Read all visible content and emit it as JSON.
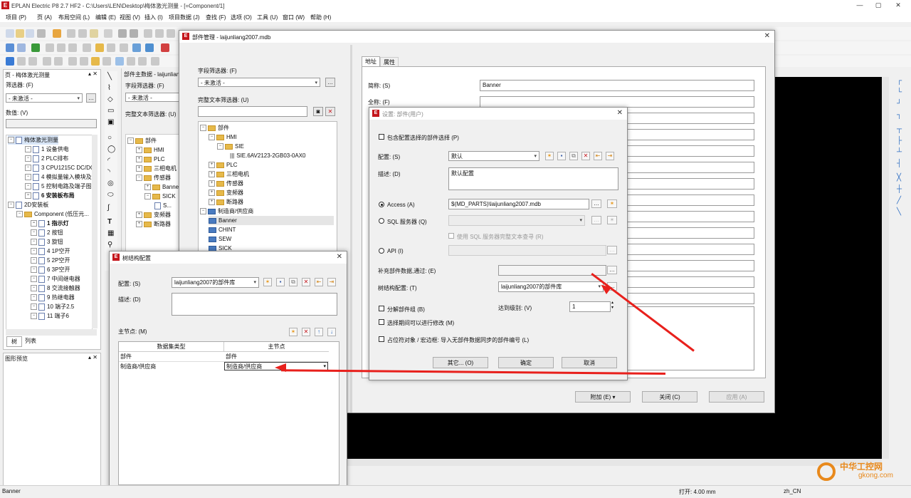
{
  "app": {
    "title": "EPLAN Electric P8 2.7 HF2 - C:\\Users\\LEN\\Desktop\\梅体激光测量 - [=Component/1]",
    "window_controls": [
      "—",
      "▢",
      "✕"
    ]
  },
  "menu": [
    "项目 (P)",
    "页 (A)",
    "布局空间 (L)",
    "编辑 (E)",
    "视图 (V)",
    "插入 (I)",
    "项目数据 (J)",
    "查找 (F)",
    "选项 (O)",
    "工具 (U)",
    "窗口 (W)",
    "帮助 (H)"
  ],
  "page_nav": {
    "title": "页 - 梅体激光测量",
    "filter_label": "筛选器: (F)",
    "filter_value": "- 未激活 -",
    "value_label": "数值: (V)",
    "tree": [
      "梅体激光测量",
      "1 设备供电",
      "2 PLC排布",
      "3 CPU1215C DC/DC",
      "4 模拟量输入模块及...",
      "5 控制电路及端子图...",
      "6 安装板布局",
      "2D安装板",
      "Component (低压元...",
      "1 指示灯",
      "2 按钮",
      "3 旋钮",
      "4 1P空开",
      "5 2P空开",
      "6 3P空开",
      "7 中间继电器",
      "8 交流接触器",
      "9 热继电器",
      "10 端子2.5",
      "11 端子6"
    ],
    "tabs": [
      "树",
      "列表"
    ]
  },
  "graphics_preview": {
    "title": "图形预览"
  },
  "parts_master_strip": {
    "title": "部件主数据 - laijunlian...",
    "field_filter_label": "字段筛选器: (F)",
    "field_filter_value": "- 未激活 -",
    "fulltext_label": "完整文本筛选器: (U)",
    "tree": [
      "部件",
      "HMI",
      "PLC",
      "三相电机",
      "传感器",
      "Banner",
      "SICK",
      "S...",
      "变频器",
      "断路器"
    ]
  },
  "parts_mgmt": {
    "title": "部件管理 - laijunliang2007.mdb",
    "field_filter_label": "字段筛选器: (F)",
    "field_filter_value": "- 未激活 -",
    "fulltext_label": "完整文本筛选器: (U)",
    "tree": [
      "部件",
      "HMI",
      "SIE",
      "SIE.6AV2123-2GB03-0AX0",
      "PLC",
      "三相电机",
      "传感器",
      "变频器",
      "断路器",
      "制造商/供应商",
      "Banner",
      "CHINT",
      "SEW",
      "SICK"
    ],
    "tabs": [
      "地址",
      "属性"
    ],
    "fields": {
      "short_name_label": "简称: (S)",
      "short_name_value": "Banner",
      "full_name_label": "全称: (F)"
    },
    "buttons": {
      "extras": "附加 (E)",
      "close": "关闭 (C)",
      "apply": "应用 (A)"
    }
  },
  "settings_dialog": {
    "title": "设置: 部件(用户)",
    "include_config_label": "包含配置选择的部件选择 (P)",
    "config_label": "配置: (S)",
    "config_value": "默认",
    "desc_label": "描述: (D)",
    "desc_value": "默认配置",
    "access_label": "Access (A)",
    "access_value": "$(MD_PARTS)\\laijunliang2007.mdb",
    "sql_label": "SQL 服务器 (Q)",
    "sql_fulltext_label": "使用 SQL 服务器完整文本查寻 (R)",
    "api_label": "API (I)",
    "supplement_label": "补充部件数据,通过: (E)",
    "tree_config_label": "树结构配置: (T)",
    "tree_config_value": "laijunliang2007的部件库",
    "split_group_label": "分解部件组 (B)",
    "level_label": "达到级别: (V)",
    "level_value": "1",
    "modify_label": "选择期间可以进行修改 (M)",
    "placeholder_label": "占位符对象 / 宏边框: 导入无部件数据同步的部件编号 (L)",
    "buttons": {
      "other": "其它... (O)",
      "ok": "确定",
      "cancel": "取消"
    }
  },
  "tree_config_dialog": {
    "title": "树结构配置",
    "config_label": "配置: (S)",
    "config_value": "laijunliang2007的部件库",
    "desc_label": "描述: (D)",
    "main_node_label": "主节点: (M)",
    "table": {
      "headers": [
        "数据集类型",
        "主节点"
      ],
      "rows": [
        [
          "部件",
          "部件"
        ],
        [
          "制造商/供应商",
          "制造商/供应商"
        ]
      ]
    }
  },
  "statusbar": {
    "left": "Banner",
    "grid": "打开: 4.00 mm",
    "lang": "zh_CN"
  },
  "watermark": {
    "site": "gkong.com",
    "brand": "中华工控网"
  },
  "colors": {
    "arrow": "#e8201c",
    "epl_red": "#c4161c",
    "canvas": "#000000",
    "folder": "#e6b94a"
  }
}
